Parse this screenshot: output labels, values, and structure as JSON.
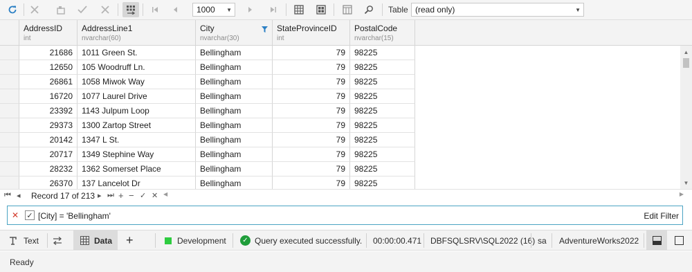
{
  "toolbar": {
    "rowlimit_value": "1000",
    "table_label": "Table",
    "table_mode_value": "(read only)",
    "icons": [
      "refresh-icon",
      "cancel-icon",
      "post-edit-icon",
      "apply-icon",
      "discard-icon",
      "grid-nav-icon",
      "first-page-icon",
      "prev-page-icon",
      "next-page-icon",
      "last-page-icon",
      "grid-view-icon",
      "card-view-icon",
      "column-chooser-icon",
      "find-icon"
    ]
  },
  "grid": {
    "columns": [
      {
        "name": "AddressID",
        "type": "int"
      },
      {
        "name": "AddressLine1",
        "type": "nvarchar(60)"
      },
      {
        "name": "City",
        "type": "nvarchar(30)"
      },
      {
        "name": "StateProvinceID",
        "type": "int"
      },
      {
        "name": "PostalCode",
        "type": "nvarchar(15)"
      }
    ],
    "rows": [
      [
        "21686",
        "1011 Green St.",
        "Bellingham",
        "79",
        "98225"
      ],
      [
        "12650",
        "105 Woodruff Ln.",
        "Bellingham",
        "79",
        "98225"
      ],
      [
        "26861",
        "1058 Miwok Way",
        "Bellingham",
        "79",
        "98225"
      ],
      [
        "16720",
        "1077 Laurel Drive",
        "Bellingham",
        "79",
        "98225"
      ],
      [
        "23392",
        "1143 Julpum Loop",
        "Bellingham",
        "79",
        "98225"
      ],
      [
        "29373",
        "1300 Zartop Street",
        "Bellingham",
        "79",
        "98225"
      ],
      [
        "20142",
        "1347 L St.",
        "Bellingham",
        "79",
        "98225"
      ],
      [
        "20717",
        "1349 Stephine Way",
        "Bellingham",
        "79",
        "98225"
      ],
      [
        "28232",
        "1362 Somerset Place",
        "Bellingham",
        "79",
        "98225"
      ],
      [
        "26370",
        "137 Lancelot Dr",
        "Bellingham",
        "79",
        "98225"
      ]
    ],
    "filtered_column": "City"
  },
  "navigator": {
    "record_text": "Record 17 of 213"
  },
  "filter_panel": {
    "enabled": true,
    "expression": "[City] = 'Bellingham'",
    "edit_label": "Edit Filter"
  },
  "bottom_bar": {
    "text_tab": "Text",
    "data_tab": "Data",
    "environment": "Development",
    "environment_color": "#2ecc40",
    "query_status": "Query executed successfully.",
    "elapsed": "00:00:00.471",
    "server": "DBFSQLSRV\\SQL2022 (16)",
    "user": "sa",
    "database": "AdventureWorks2022"
  },
  "status_bar": {
    "text": "Ready"
  }
}
